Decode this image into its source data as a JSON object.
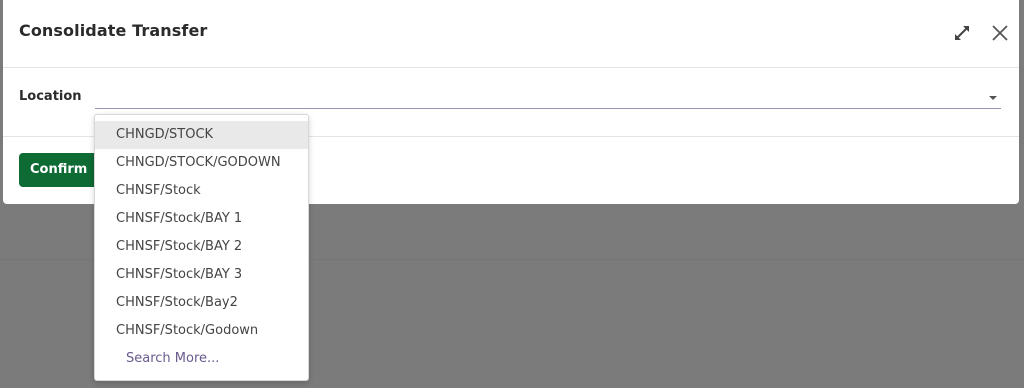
{
  "dialog": {
    "title": "Consolidate Transfer",
    "expand_icon": "expand-icon",
    "close_icon": "close-icon"
  },
  "form": {
    "location_label": "Location",
    "location_value": ""
  },
  "footer": {
    "confirm_label": "Confirm"
  },
  "dropdown": {
    "items": [
      "CHNGD/STOCK",
      "CHNGD/STOCK/GODOWN",
      "CHNSF/Stock",
      "CHNSF/Stock/BAY 1",
      "CHNSF/Stock/BAY 2",
      "CHNSF/Stock/BAY 3",
      "CHNSF/Stock/Bay2",
      "CHNSF/Stock/Godown"
    ],
    "search_more": "Search More..."
  },
  "colors": {
    "confirm": "#0f6b34",
    "link": "#6a5a8e",
    "input_underline": "#9b92b4",
    "backdrop": "#7b7b7b"
  }
}
